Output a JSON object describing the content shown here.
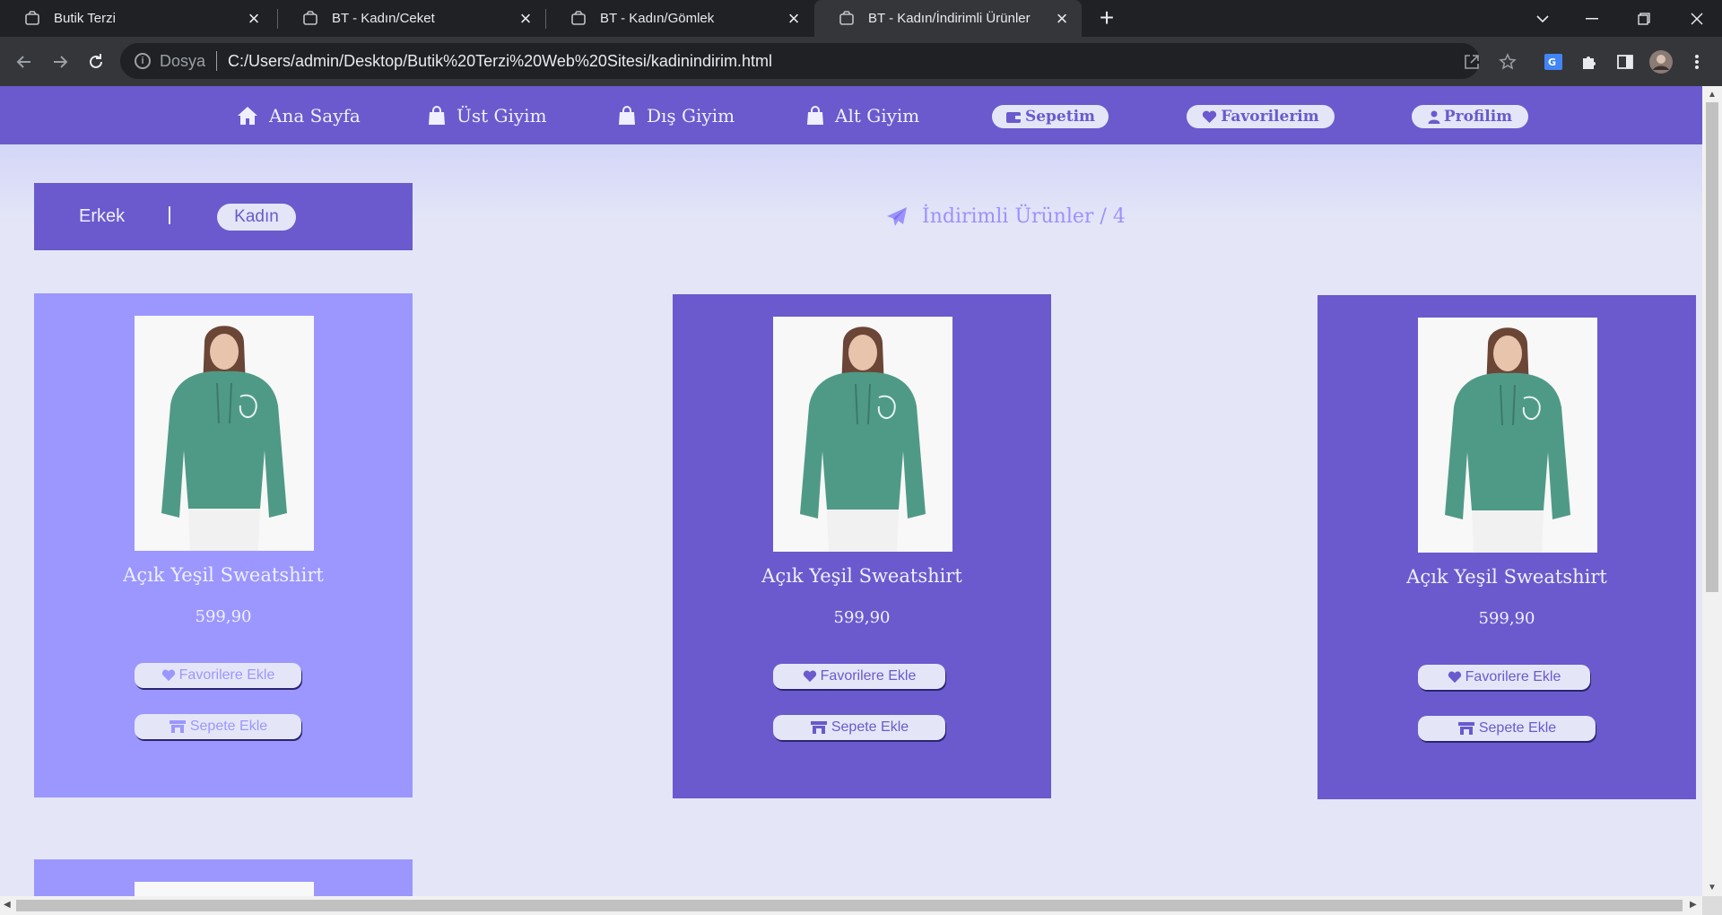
{
  "browser": {
    "tabs": [
      {
        "title": "Butik Terzi"
      },
      {
        "title": "BT - Kadın/Ceket"
      },
      {
        "title": "BT - Kadın/Gömlek"
      },
      {
        "title": "BT - Kadın/İndirimli Ürünler"
      }
    ],
    "active_tab": 3,
    "address": {
      "scheme_label": "Dosya",
      "url": "C:/Users/admin/Desktop/Butik%20Terzi%20Web%20Sitesi/kadinindirim.html"
    }
  },
  "site_nav": {
    "home": "Ana Sayfa",
    "tops": "Üst Giyim",
    "outerwear": "Dış Giyim",
    "bottoms": "Alt Giyim",
    "cart": "Sepetim",
    "favorites": "Favorilerim",
    "profile": "Profilim"
  },
  "gender": {
    "male": "Erkek",
    "female": "Kadın",
    "selected": "Kadın"
  },
  "section": {
    "title": "İndirimli Ürünler / 4"
  },
  "products": [
    {
      "name": "Açık Yeşil Sweatshirt",
      "price": "599,90",
      "fav_label": "Favorilere Ekle",
      "cart_label": "Sepete Ekle"
    },
    {
      "name": "Açık Yeşil Sweatshirt",
      "price": "599,90",
      "fav_label": "Favorilere Ekle",
      "cart_label": "Sepete Ekle"
    },
    {
      "name": "Açık Yeşil Sweatshirt",
      "price": "599,90",
      "fav_label": "Favorilere Ekle",
      "cart_label": "Sepete Ekle"
    }
  ],
  "colors": {
    "brand": "#6a5acd",
    "brand_light": "#9b97ff",
    "page_bg": "#e4e6f7"
  }
}
